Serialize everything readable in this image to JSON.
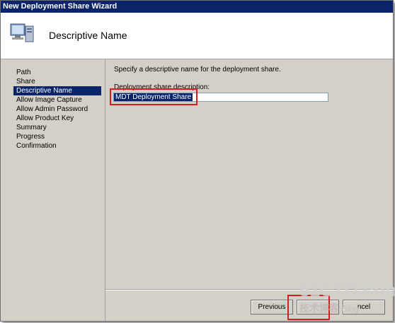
{
  "window": {
    "title": "New Deployment Share Wizard"
  },
  "header": {
    "title": "Descriptive Name",
    "icon": "computer-monitor-icon"
  },
  "sidebar": {
    "items": [
      {
        "label": "Path"
      },
      {
        "label": "Share"
      },
      {
        "label": "Descriptive Name",
        "active": true
      },
      {
        "label": "Allow Image Capture"
      },
      {
        "label": "Allow Admin Password"
      },
      {
        "label": "Allow Product Key"
      },
      {
        "label": "Summary"
      },
      {
        "label": "Progress"
      },
      {
        "label": "Confirmation"
      }
    ]
  },
  "main": {
    "prompt": "Specify a descriptive name for the deployment share.",
    "field_label": "Deployment share description:",
    "field_value": "MDT Deployment Share"
  },
  "buttons": {
    "previous": "Previous",
    "next": "",
    "cancel": "ncel"
  },
  "watermark": {
    "line1": "51CTO.com",
    "line2": "技术博客",
    "line2_suffix": "Blog"
  },
  "colors": {
    "selection": "#0a246a",
    "highlight_box": "#d21f1f",
    "dialog_bg": "#d4d0c8"
  }
}
